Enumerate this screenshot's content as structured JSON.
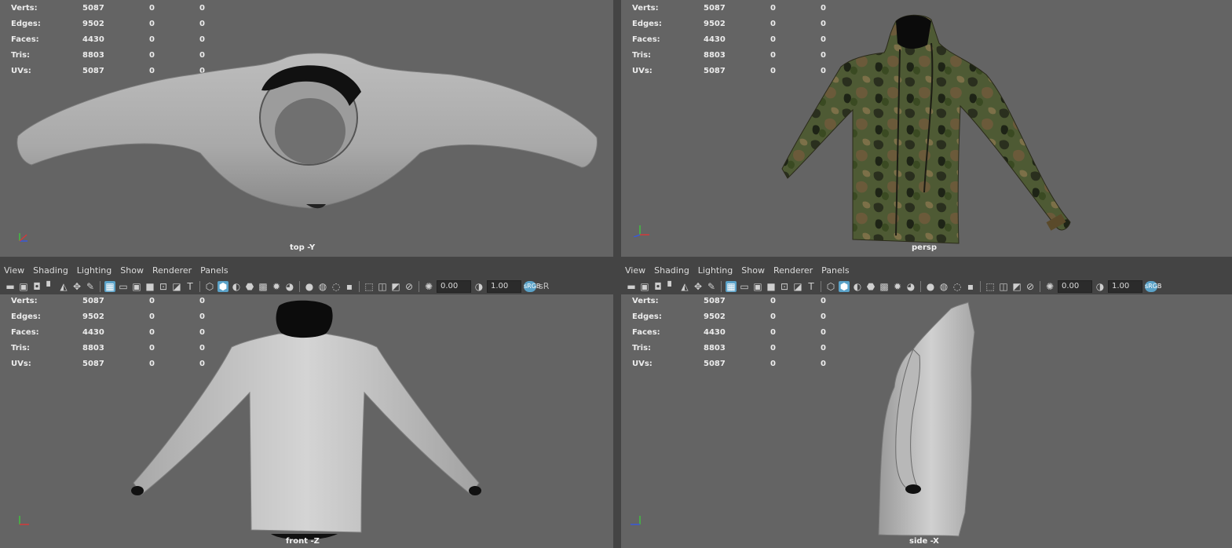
{
  "menu": [
    "View",
    "Shading",
    "Lighting",
    "Show",
    "Renderer",
    "Panels"
  ],
  "toolbar": {
    "exposure": "0.00",
    "gamma": "1.00",
    "color_mgmt_badge": "sRGB",
    "color_mgmt_text": "sR"
  },
  "stats": [
    {
      "label": "Verts:",
      "value": "5087",
      "sel": "0",
      "comp": "0"
    },
    {
      "label": "Edges:",
      "value": "9502",
      "sel": "0",
      "comp": "0"
    },
    {
      "label": "Faces:",
      "value": "4430",
      "sel": "0",
      "comp": "0"
    },
    {
      "label": "Tris:",
      "value": "8803",
      "sel": "0",
      "comp": "0"
    },
    {
      "label": "UVs:",
      "value": "5087",
      "sel": "0",
      "comp": "0"
    }
  ],
  "viewports": {
    "top": {
      "camera": "top -Y"
    },
    "persp": {
      "camera": "persp"
    },
    "front": {
      "camera": "front -Z"
    },
    "side": {
      "camera": "side -X"
    }
  },
  "axis": {
    "x": "x",
    "y": "y",
    "z": "z",
    "x_color": "#d33a3a",
    "y_color": "#40c040",
    "z_color": "#3a5ad8"
  },
  "colors": {
    "viewport_bg": "#646464",
    "panel_bar": "#444444",
    "accent": "#5aa2c8"
  }
}
